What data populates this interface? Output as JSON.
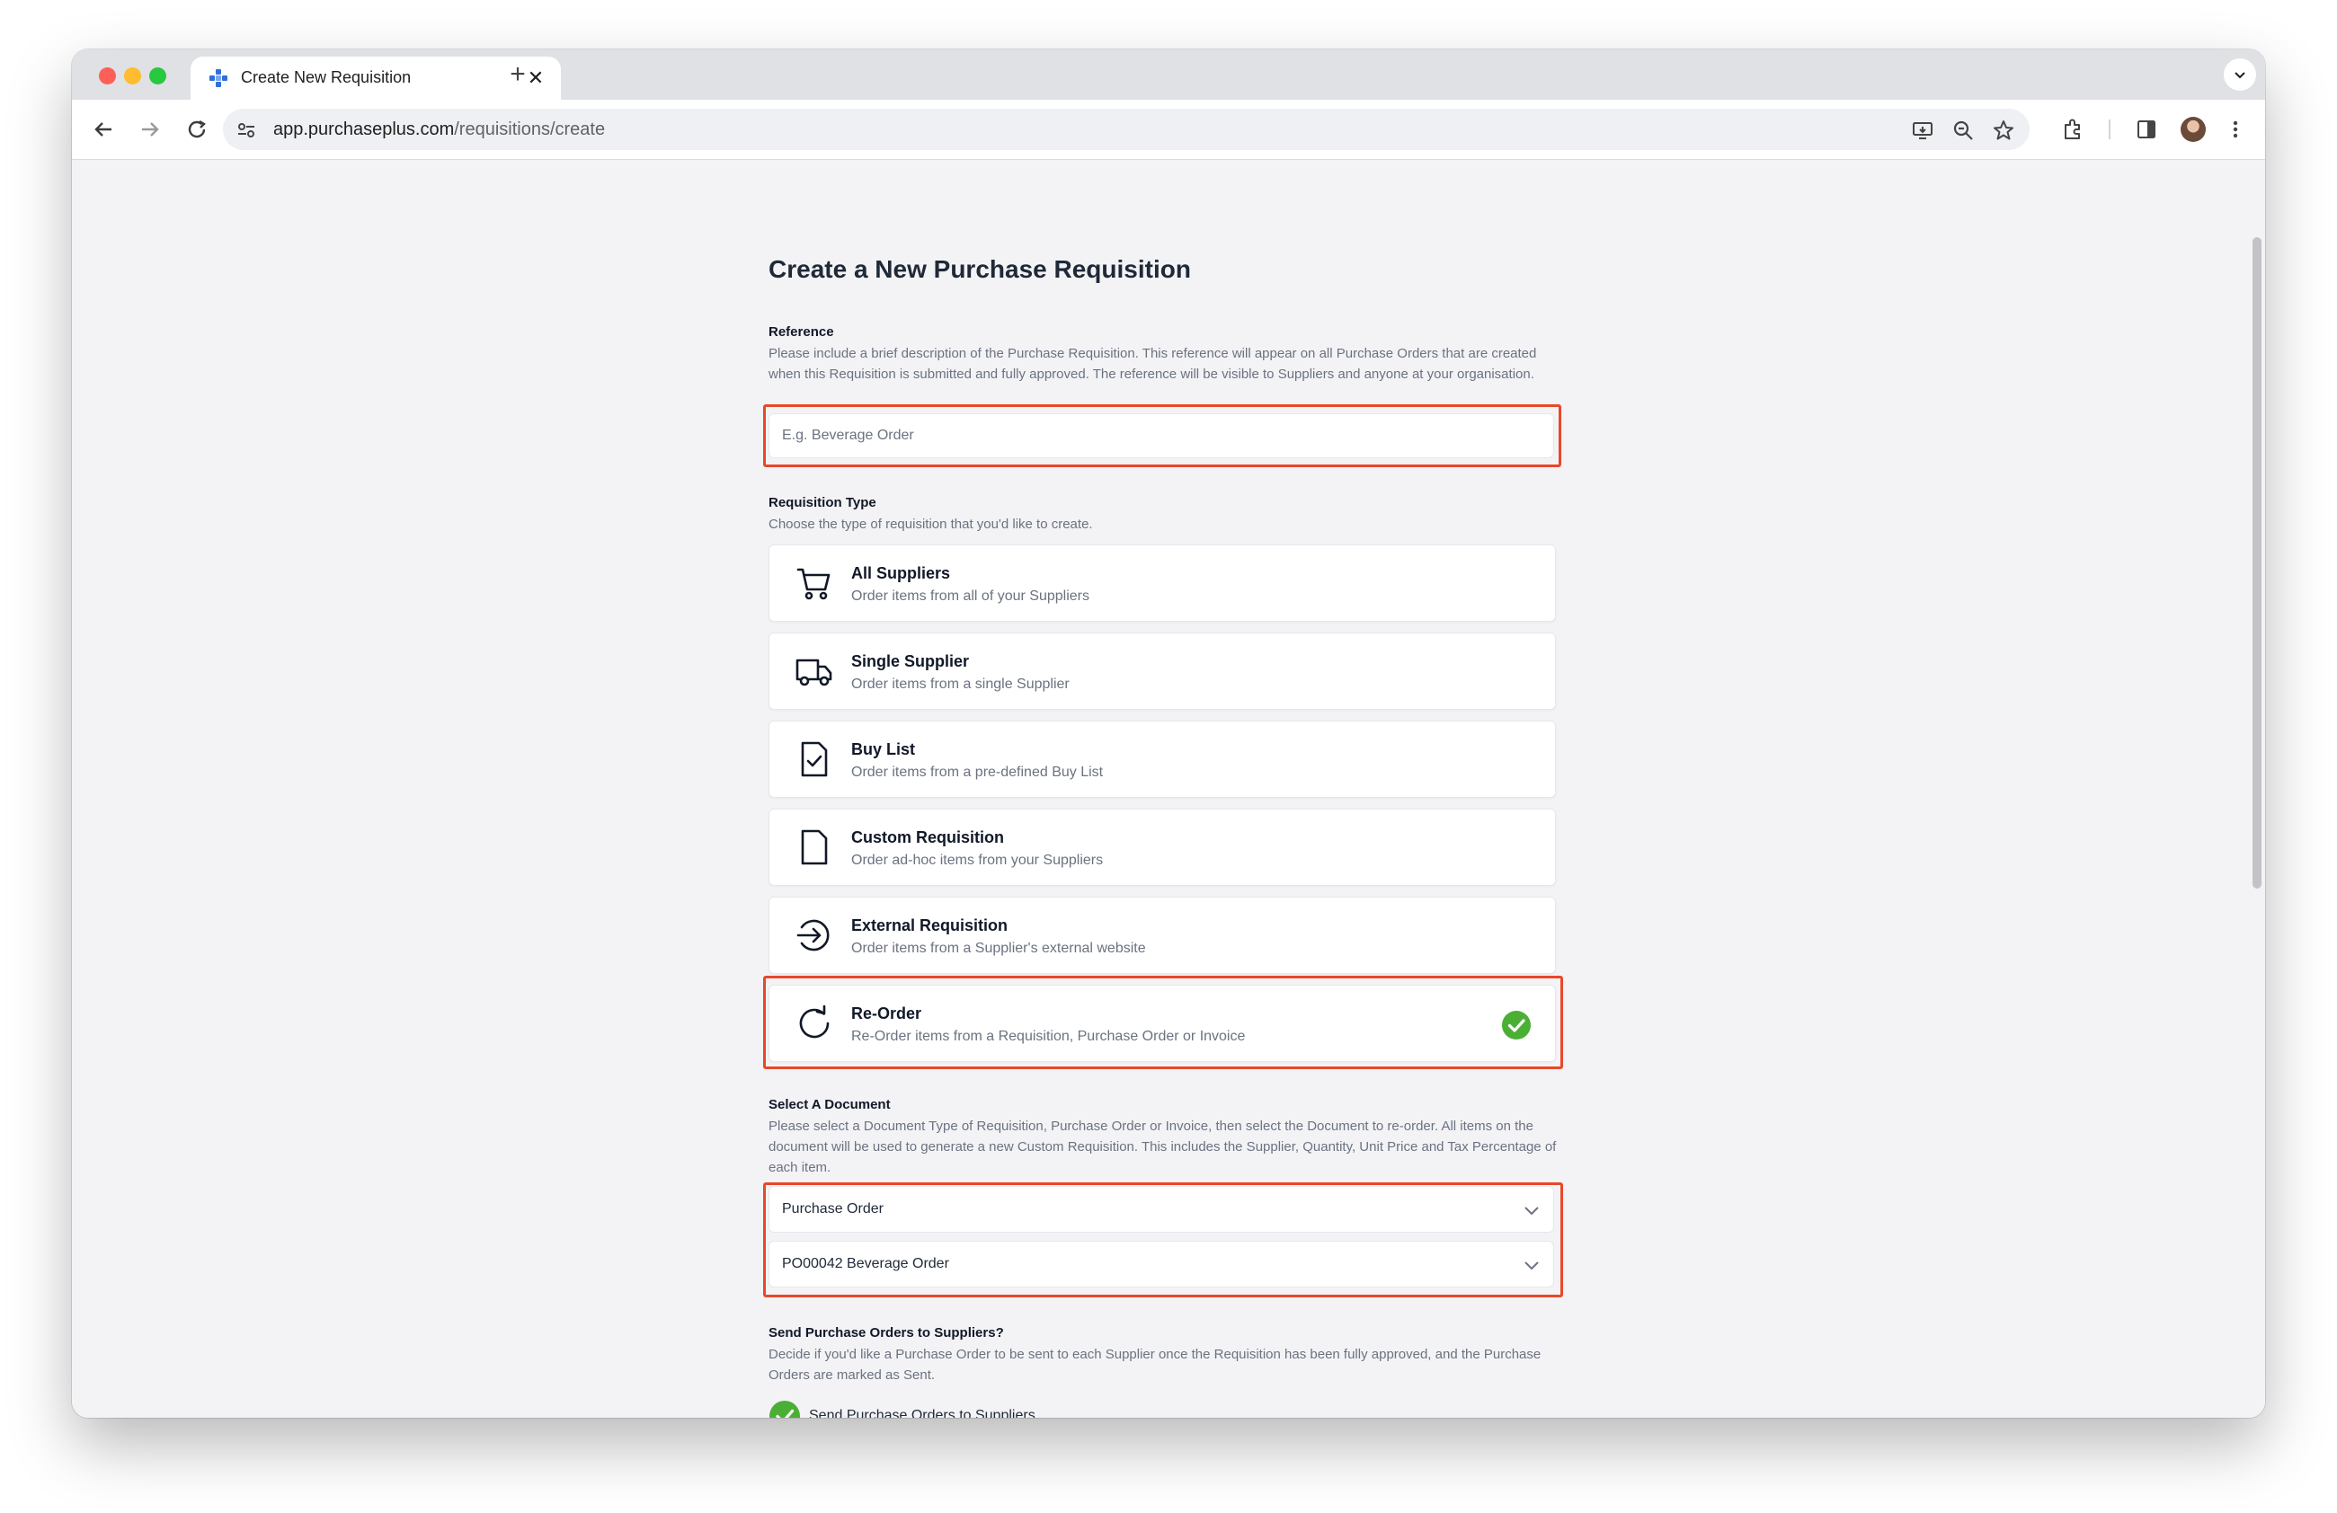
{
  "browser": {
    "tab_title": "Create New Requisition",
    "new_tab_glyph": "+",
    "close_glyph": "✕",
    "url_host": "app.purchaseplus.com",
    "url_path": "/requisitions/create"
  },
  "page": {
    "title": "Create a New Purchase Requisition"
  },
  "reference": {
    "label": "Reference",
    "description": "Please include a brief description of the Purchase Requisition. This reference will appear on all Purchase Orders that are created when this Requisition is submitted and fully approved. The reference will be visible to Suppliers and anyone at your organisation.",
    "placeholder": "E.g. Beverage Order",
    "value": ""
  },
  "requisition_type": {
    "label": "Requisition Type",
    "description": "Choose the type of requisition that you'd like to create.",
    "selected": "Re-Order",
    "options": [
      {
        "title": "All Suppliers",
        "subtitle": "Order items from all of your Suppliers",
        "icon": "cart-icon"
      },
      {
        "title": "Single Supplier",
        "subtitle": "Order items from a single Supplier",
        "icon": "truck-icon"
      },
      {
        "title": "Buy List",
        "subtitle": "Order items from a pre-defined Buy List",
        "icon": "document-check-icon"
      },
      {
        "title": "Custom Requisition",
        "subtitle": "Order ad-hoc items from your Suppliers",
        "icon": "blank-document-icon"
      },
      {
        "title": "External Requisition",
        "subtitle": "Order items from a Supplier's external website",
        "icon": "arrow-circle-right-icon"
      },
      {
        "title": "Re-Order",
        "subtitle": "Re-Order items from a Requisition, Purchase Order or Invoice",
        "icon": "refresh-icon"
      }
    ]
  },
  "select_document": {
    "label": "Select A Document",
    "description": "Please select a Document Type of Requisition, Purchase Order or Invoice, then select the Document to re-order. All items on the document will be used to generate a new Custom Requisition. This includes the Supplier, Quantity, Unit Price and Tax Percentage of each item.",
    "document_type": "Purchase Order",
    "document": "PO00042 Beverage Order"
  },
  "send_orders": {
    "label": "Send Purchase Orders to Suppliers?",
    "description": "Decide if you'd like a Purchase Order to be sent to each Supplier once the Requisition has been fully approved, and the Purchase Orders are marked as Sent.",
    "checkbox_label": "Send Purchase Orders to Suppliers",
    "checked": true
  },
  "colors": {
    "highlight": "#e8482a",
    "success": "#4caf35",
    "brand_favicon": "#2f6fdc"
  }
}
